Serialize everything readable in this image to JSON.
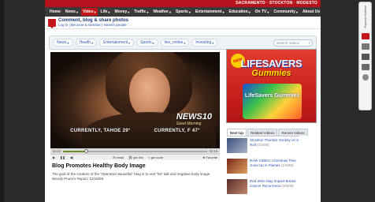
{
  "header": {
    "cities": "SACRAMENTO · STOCKTON · MODESTO"
  },
  "nav": [
    {
      "label": "Home",
      "caret": false,
      "active": false
    },
    {
      "label": "News",
      "caret": true,
      "active": false
    },
    {
      "label": "Video",
      "caret": true,
      "active": true
    },
    {
      "label": "Life",
      "caret": true,
      "active": false
    },
    {
      "label": "Money",
      "caret": true,
      "active": false
    },
    {
      "label": "Traffic",
      "caret": true,
      "active": false
    },
    {
      "label": "Weather",
      "caret": true,
      "active": false
    },
    {
      "label": "Sports",
      "caret": true,
      "active": false
    },
    {
      "label": "Entertainment",
      "caret": true,
      "active": false
    },
    {
      "label": "Education",
      "caret": true,
      "active": false
    },
    {
      "label": "On TV",
      "caret": true,
      "active": false
    },
    {
      "label": "Community",
      "caret": true,
      "active": false
    },
    {
      "label": "About Us",
      "caret": true,
      "active": false
    }
  ],
  "comment": {
    "title": "Comment, blog & share photos",
    "login": "Log in",
    "register": "Become a member",
    "search_people": "Search people"
  },
  "filters": [
    "News",
    "Health",
    "Entertainment",
    "Sports",
    "live_online",
    "Investing"
  ],
  "search": {
    "placeholder": "Search Videos"
  },
  "video": {
    "lower_left": "CURRENTLY, TAHOE 29°",
    "lower_mid": "CURRENTLY, F 47°",
    "logo": "NEWS10",
    "logo_sub": "Good Morning",
    "time_current": "00:22",
    "time_total": "02:19",
    "progress": 0.16,
    "controls": {
      "email": "email",
      "get_link": "get link",
      "get_code": "get code",
      "favorite": "Favorite"
    }
  },
  "article": {
    "headline": "Blog Promotes Healthy Body Image",
    "description": "The goal of the creators of the \"Operation Beautiful\" blog is to end \"fat\" talk and negative body image. Wendy Pruen's Report, 12/15/09"
  },
  "ad": {
    "badge": "NEW",
    "brand": "LIFESAVERS",
    "sub": "Gummies",
    "pack_label": "LifeSavers Gummies"
  },
  "tabs": [
    "Next Up",
    "Related Videos",
    "Recent Videos"
  ],
  "related": [
    {
      "title": "Stockton Thunder Hockey on a Roll",
      "duration": "(2/4/09)",
      "thumb_color": "#3a4f7a"
    },
    {
      "title": "RAW VIDEO: Christmas Tree Goes Up in Flames",
      "duration": "(1/3/09)",
      "thumb_color": "#7a2a1a"
    },
    {
      "title": "Red Wine May Impact Breast Cancer Recurrence",
      "duration": "(1/5/09)",
      "thumb_color": "#5a2a2a"
    }
  ],
  "sidebar": {
    "label": "Expand Sidebar"
  }
}
